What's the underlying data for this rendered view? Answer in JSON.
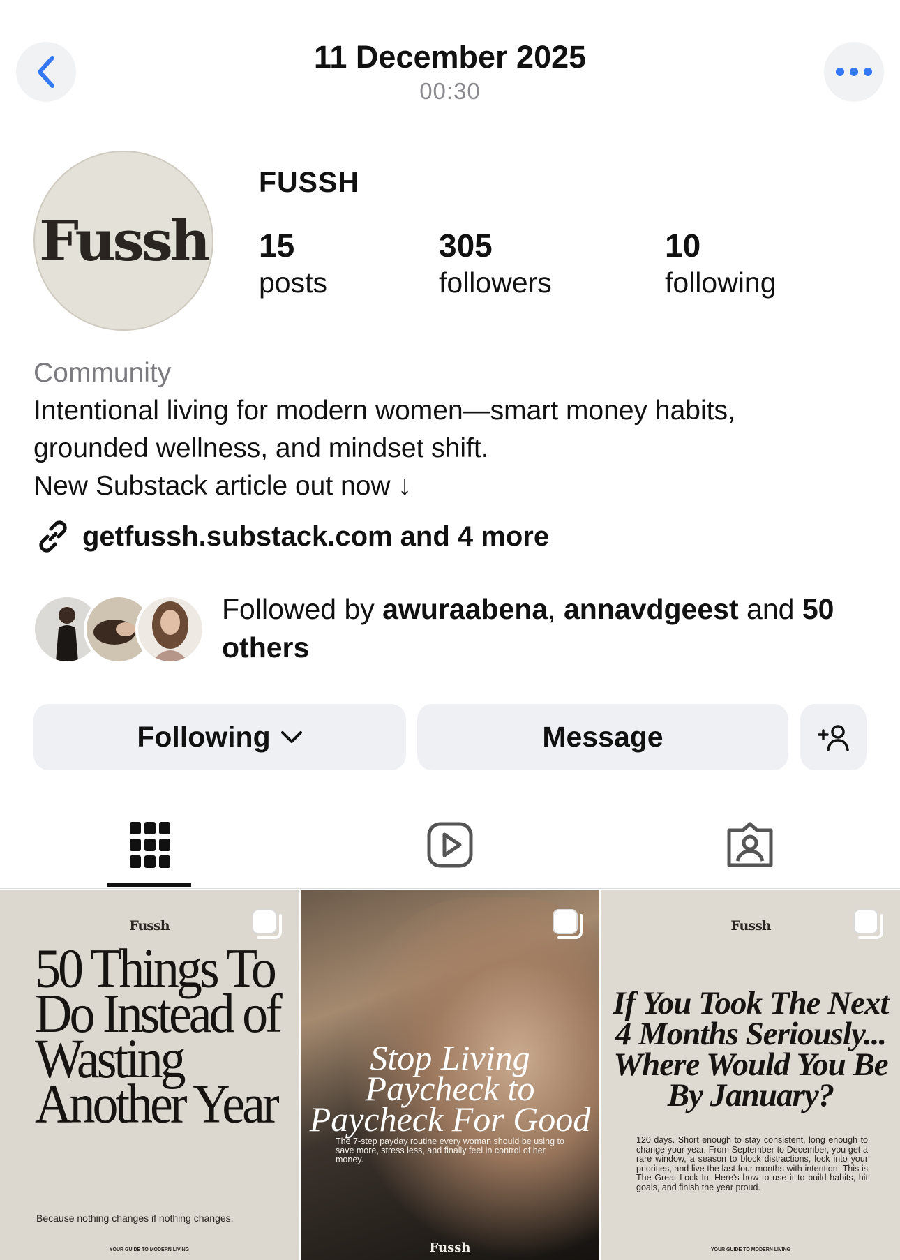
{
  "header": {
    "date": "11 December 2025",
    "time": "00:30"
  },
  "profile": {
    "avatar_text": "Fussh",
    "username": "FUSSH",
    "stats": [
      {
        "value": "15",
        "label": "posts"
      },
      {
        "value": "305",
        "label": "followers"
      },
      {
        "value": "10",
        "label": "following"
      }
    ],
    "category": "Community",
    "bio_lines": [
      "Intentional living for modern women—smart money habits,",
      "grounded wellness, and mindset shift.",
      "New Substack article out now ↓"
    ],
    "link_text": "getfussh.substack.com and 4 more"
  },
  "followed_by": {
    "prefix": "Followed by ",
    "user1": "awuraabena",
    "separator": ", ",
    "user2": "annavdgeest",
    "connector": " and ",
    "others": "50 others"
  },
  "actions": {
    "following_label": "Following",
    "message_label": "Message"
  },
  "tabs": [
    {
      "icon": "grid-icon",
      "active": true
    },
    {
      "icon": "reels-icon",
      "active": false
    },
    {
      "icon": "tagged-icon",
      "active": false
    }
  ],
  "posts": [
    {
      "brand": "Fussh",
      "title": "50 Things To Do Instead of Wasting Another Year",
      "subtitle": "Because nothing changes if nothing changes.",
      "footer": "YOUR GUIDE TO MODERN LIVING"
    },
    {
      "title": "Stop Living Paycheck to Paycheck For Good",
      "subtitle": "The 7-step payday routine every woman should be using to save more, stress less, and finally feel in control of her money.",
      "brand": "Fussh"
    },
    {
      "brand": "Fussh",
      "title": "If You Took The Next 4 Months Seriously... Where Would You Be By January?",
      "body": "120 days. Short enough to stay consistent, long enough to change your year. From September to December, you get a rare window, a season to block distractions, lock into your priorities, and live the last four months with intention. This is The Great Lock In. Here's how to use it to build habits, hit goals, and finish the year proud.",
      "footer": "YOUR GUIDE TO MODERN LIVING"
    }
  ],
  "colors": {
    "accent_blue": "#3478f6",
    "button_bg": "#eff0f3",
    "secondary_text": "#8a8a8e"
  }
}
